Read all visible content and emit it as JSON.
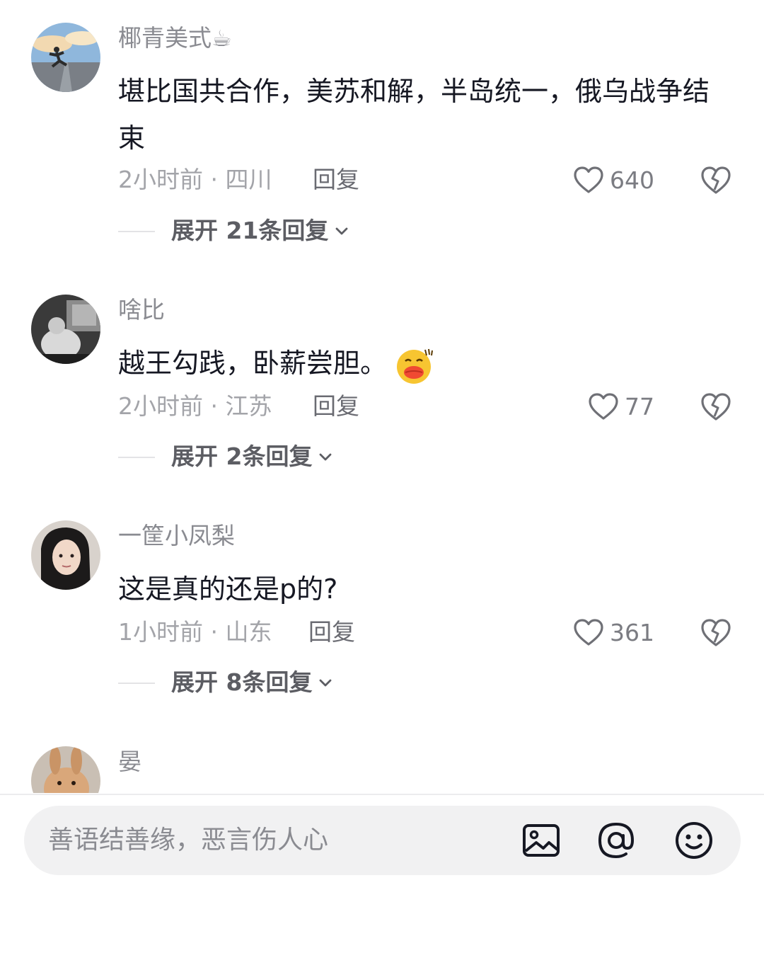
{
  "comments": [
    {
      "username": "椰青美式",
      "username_emoji": "☕",
      "text": "堪比国共合作，美苏和解，半岛统一，俄乌战争结束",
      "time_location": "2小时前 · 四川",
      "reply_label": "回复",
      "likes": "640",
      "expand_label": "展开 21条回复",
      "avatar_icon": "avatar-runner-sky"
    },
    {
      "username": "啥比",
      "text": "越王勾践，卧薪尝胆。",
      "emoji": "duck-lips-emoji",
      "time_location": "2小时前 · 江苏",
      "reply_label": "回复",
      "likes": "77",
      "expand_label": "展开 2条回复",
      "avatar_icon": "avatar-grayscale-person"
    },
    {
      "username": "一筐小凤梨",
      "text": "这是真的还是p的?",
      "time_location": "1小时前 · 山东",
      "reply_label": "回复",
      "likes": "361",
      "expand_label": "展开 8条回复",
      "avatar_icon": "avatar-girl-portrait"
    },
    {
      "username": "晏",
      "avatar_icon": "avatar-rabbit"
    }
  ],
  "input_bar": {
    "placeholder": "善语结善缘，恶言伤人心",
    "icons": [
      "image-icon",
      "at-icon",
      "emoji-icon"
    ]
  },
  "colors": {
    "text_primary": "#161823",
    "text_secondary": "#a3a4a9",
    "username": "#8a8b91",
    "input_background": "#f1f1f2"
  }
}
